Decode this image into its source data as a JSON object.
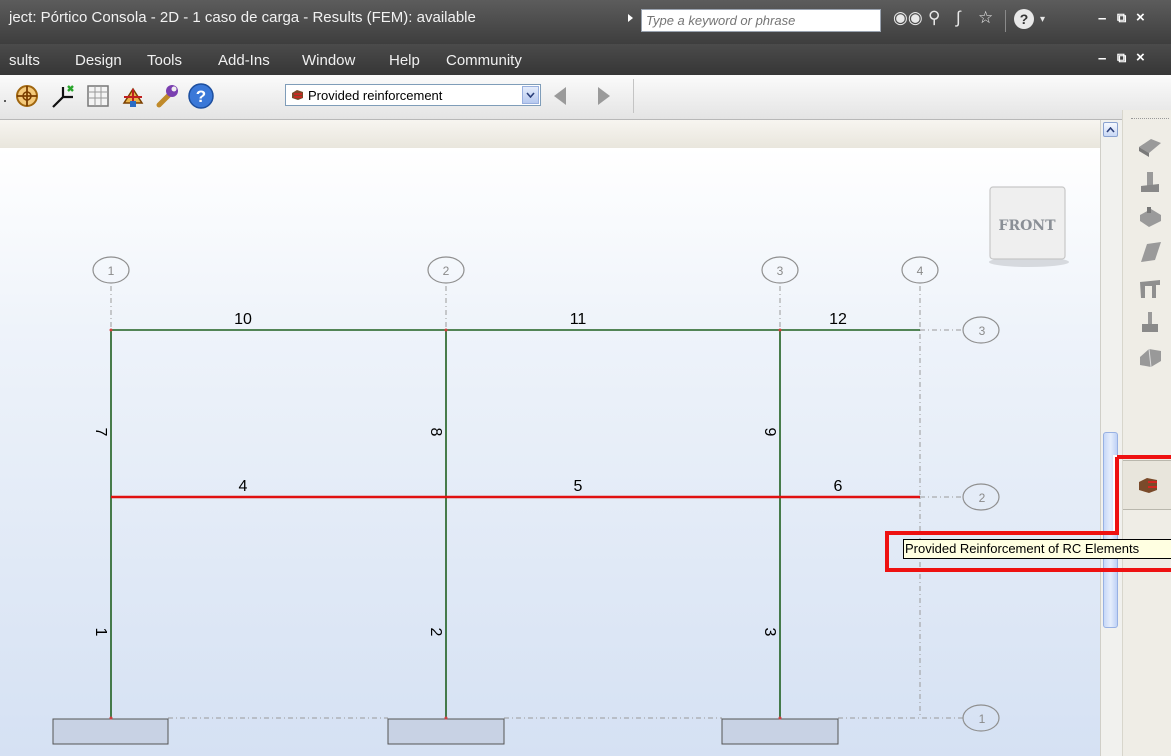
{
  "window": {
    "title": "ject: Pórtico Consola - 2D - 1 caso de carga - Results (FEM): available"
  },
  "search": {
    "placeholder": "Type a keyword or phrase"
  },
  "menu": {
    "items": [
      "sults",
      "Design",
      "Tools",
      "Add-Ins",
      "Window",
      "Help",
      "Community"
    ]
  },
  "toolbar": {
    "result_select_value": "Provided reinforcement",
    "icons": [
      "zoom-icon",
      "axis-icon",
      "table-icon",
      "structure-icon",
      "wrench-icon",
      "help-icon"
    ]
  },
  "viewcube": {
    "label": "FRONT"
  },
  "grid": {
    "vertical_axes": [
      "1",
      "2",
      "3",
      "4"
    ],
    "horizontal_levels": [
      "3",
      "2",
      "1"
    ]
  },
  "members": {
    "beams_top": [
      "10",
      "11",
      "12"
    ],
    "beams_mid": [
      "4",
      "5",
      "6"
    ],
    "columns_upper": [
      "7",
      "8",
      "9"
    ],
    "columns_lower": [
      "1",
      "2",
      "3"
    ]
  },
  "tooltip": {
    "text": "Provided Reinforcement of RC Elements"
  },
  "colors": {
    "member_green": "#1f5f1f",
    "highlight_red": "#e01010",
    "accent_red": "#ee1111"
  },
  "right_panel": {
    "icons": [
      "slab-icon",
      "column-icon",
      "beam-icon",
      "wall-icon",
      "frame-icon",
      "foundation-icon",
      "element-icon",
      "provided-reinforcement-icon"
    ]
  }
}
